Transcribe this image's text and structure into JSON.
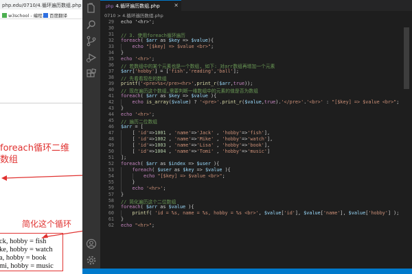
{
  "browser": {
    "tab_title": "php.edu/0710/4.循环遍历数组.php",
    "bookmarks": [
      {
        "label": "w3school - 编程...",
        "color": "#4caf50"
      },
      {
        "label": "百度翻译",
        "color": "#2f6fe0"
      }
    ],
    "note_foreach": "foreach循环二维\n数组",
    "note_simplify": "简化这个循环",
    "output_lines": [
      "ck, hobby = fish",
      "ke, hobby = watch",
      "a, hobby = book",
      "mi, hobby = music"
    ]
  },
  "editor": {
    "tab_label": "4.循环遍历数组.php",
    "tab_badge": "php",
    "breadcrumb": "0710 > 4.循环遍历数组.php",
    "accent_color": "#007acc"
  },
  "code": [
    {
      "n": "29",
      "ind": 0,
      "t": [
        [
          "pn",
          "echo '<hr>';"
        ]
      ]
    },
    {
      "n": "30",
      "ind": 0,
      "t": []
    },
    {
      "n": "31",
      "ind": 0,
      "t": [
        [
          "cm",
          "// 3. 使用foreach循环遍历"
        ]
      ]
    },
    {
      "n": "32",
      "ind": 0,
      "t": [
        [
          "kw",
          "foreach"
        ],
        [
          "pn",
          "( "
        ],
        [
          "var",
          "$arr"
        ],
        [
          "pn",
          " as "
        ],
        [
          "var",
          "$key"
        ],
        [
          "pn",
          " => "
        ],
        [
          "var",
          "$value"
        ],
        [
          "pn",
          "){"
        ]
      ]
    },
    {
      "n": "33",
      "ind": 1,
      "t": [
        [
          "kw",
          "echo"
        ],
        [
          "pn",
          " "
        ],
        [
          "str",
          "\"[$key] => $value <br>\""
        ],
        [
          "pn",
          ";"
        ]
      ]
    },
    {
      "n": "34",
      "ind": 0,
      "t": [
        [
          "pn",
          "}"
        ]
      ]
    },
    {
      "n": "35",
      "ind": 0,
      "t": [
        [
          "kw",
          "echo"
        ],
        [
          "pn",
          " "
        ],
        [
          "str",
          "'<hr>'"
        ],
        [
          "pn",
          ";"
        ]
      ]
    },
    {
      "n": "36",
      "ind": 0,
      "t": [
        [
          "cm",
          "// 若数组中的某个元素也是一个数组, 如下: 对arr数组再增加一个元素"
        ]
      ]
    },
    {
      "n": "37",
      "ind": 0,
      "t": [
        [
          "var",
          "$arr"
        ],
        [
          "pn",
          "["
        ],
        [
          "str",
          "'hobby'"
        ],
        [
          "pn",
          "] = ["
        ],
        [
          "str",
          "'fish'"
        ],
        [
          "pn",
          ","
        ],
        [
          "str",
          "'reading'"
        ],
        [
          "pn",
          ","
        ],
        [
          "str",
          "'ball'"
        ],
        [
          "pn",
          "];"
        ]
      ]
    },
    {
      "n": "38",
      "ind": 0,
      "t": [
        [
          "cm",
          "// 先看看现在的数组"
        ]
      ]
    },
    {
      "n": "39",
      "ind": 0,
      "t": [
        [
          "fn",
          "printf"
        ],
        [
          "pn",
          "("
        ],
        [
          "str",
          "'<pre>%s</pre><hr>'"
        ],
        [
          "pn",
          ","
        ],
        [
          "fn",
          "print_r"
        ],
        [
          "pn",
          "("
        ],
        [
          "var",
          "$arr"
        ],
        [
          "pn",
          ","
        ],
        [
          "kw",
          "true"
        ],
        [
          "pn",
          "));"
        ]
      ]
    },
    {
      "n": "40",
      "ind": 0,
      "t": [
        [
          "cm",
          "// 现在遍历这个数组,需要判断一维数组中的元素的值是否为数组"
        ]
      ]
    },
    {
      "n": "41",
      "ind": 0,
      "t": [
        [
          "kw",
          "foreach"
        ],
        [
          "pn",
          "( "
        ],
        [
          "var",
          "$arr"
        ],
        [
          "pn",
          " as "
        ],
        [
          "var",
          "$key"
        ],
        [
          "pn",
          " => "
        ],
        [
          "var",
          "$value"
        ],
        [
          "pn",
          " ){"
        ]
      ]
    },
    {
      "n": "42",
      "ind": 1,
      "t": [
        [
          "kw",
          "echo"
        ],
        [
          "pn",
          " "
        ],
        [
          "fn",
          "is_array"
        ],
        [
          "pn",
          "("
        ],
        [
          "var",
          "$value"
        ],
        [
          "pn",
          ") ? "
        ],
        [
          "str",
          "'<pre>'"
        ],
        [
          "pn",
          "."
        ],
        [
          "fn",
          "print_r"
        ],
        [
          "pn",
          "("
        ],
        [
          "var",
          "$value"
        ],
        [
          "pn",
          ","
        ],
        [
          "kw",
          "true"
        ],
        [
          "pn",
          ")."
        ],
        [
          "str",
          "'</pre>'"
        ],
        [
          "pn",
          "."
        ],
        [
          "str",
          "'<br>'"
        ],
        [
          "pn",
          " : "
        ],
        [
          "str",
          "\"[$key] => $value <br>\""
        ],
        [
          "pn",
          ";"
        ]
      ]
    },
    {
      "n": "43",
      "ind": 0,
      "t": [
        [
          "pn",
          "}"
        ]
      ]
    },
    {
      "n": "44",
      "ind": 0,
      "t": [
        [
          "kw",
          "echo"
        ],
        [
          "pn",
          " "
        ],
        [
          "str",
          "'<hr>'"
        ],
        [
          "pn",
          ";"
        ]
      ]
    },
    {
      "n": "45",
      "ind": 0,
      "t": [
        [
          "cm",
          "// 遍历二位数组"
        ]
      ]
    },
    {
      "n": "46",
      "ind": 0,
      "t": [
        [
          "var",
          "$arr"
        ],
        [
          "pn",
          " = ["
        ]
      ]
    },
    {
      "n": "47",
      "ind": 1,
      "t": [
        [
          "pn",
          "[ "
        ],
        [
          "str",
          "'id'"
        ],
        [
          "pn",
          "=>"
        ],
        [
          "num",
          "1001"
        ],
        [
          "pn",
          " , "
        ],
        [
          "str",
          "'name'"
        ],
        [
          "pn",
          "=>"
        ],
        [
          "str",
          "'Jack'"
        ],
        [
          "pn",
          " , "
        ],
        [
          "str",
          "'hobby'"
        ],
        [
          "pn",
          "=>"
        ],
        [
          "str",
          "'fish'"
        ],
        [
          "pn",
          "],"
        ]
      ]
    },
    {
      "n": "48",
      "ind": 1,
      "t": [
        [
          "pn",
          "[ "
        ],
        [
          "str",
          "'id'"
        ],
        [
          "pn",
          "=>"
        ],
        [
          "num",
          "1002"
        ],
        [
          "pn",
          " , "
        ],
        [
          "str",
          "'name'"
        ],
        [
          "pn",
          "=>"
        ],
        [
          "str",
          "'Mike'"
        ],
        [
          "pn",
          " , "
        ],
        [
          "str",
          "'hobby'"
        ],
        [
          "pn",
          "=>"
        ],
        [
          "str",
          "'watch'"
        ],
        [
          "pn",
          "],"
        ]
      ]
    },
    {
      "n": "49",
      "ind": 1,
      "t": [
        [
          "pn",
          "[ "
        ],
        [
          "str",
          "'id'"
        ],
        [
          "pn",
          "=>"
        ],
        [
          "num",
          "1003"
        ],
        [
          "pn",
          " , "
        ],
        [
          "str",
          "'name'"
        ],
        [
          "pn",
          "=>"
        ],
        [
          "str",
          "'Lisa'"
        ],
        [
          "pn",
          " , "
        ],
        [
          "str",
          "'hobby'"
        ],
        [
          "pn",
          "=>"
        ],
        [
          "str",
          "'book'"
        ],
        [
          "pn",
          "],"
        ]
      ]
    },
    {
      "n": "50",
      "ind": 1,
      "t": [
        [
          "pn",
          "[ "
        ],
        [
          "str",
          "'id'"
        ],
        [
          "pn",
          "=>"
        ],
        [
          "num",
          "1004"
        ],
        [
          "pn",
          " , "
        ],
        [
          "str",
          "'name'"
        ],
        [
          "pn",
          "=>"
        ],
        [
          "str",
          "'Tomi'"
        ],
        [
          "pn",
          " , "
        ],
        [
          "str",
          "'hobby'"
        ],
        [
          "pn",
          "=>"
        ],
        [
          "str",
          "'music'"
        ],
        [
          "pn",
          "]"
        ]
      ]
    },
    {
      "n": "51",
      "ind": 0,
      "t": [
        [
          "pn",
          "];"
        ]
      ]
    },
    {
      "n": "52",
      "ind": 0,
      "t": [
        [
          "kw",
          "foreach"
        ],
        [
          "pn",
          "( "
        ],
        [
          "var",
          "$arr"
        ],
        [
          "pn",
          " as "
        ],
        [
          "var",
          "$index"
        ],
        [
          "pn",
          " => "
        ],
        [
          "var",
          "$user"
        ],
        [
          "pn",
          " ){"
        ]
      ]
    },
    {
      "n": "53",
      "ind": 1,
      "t": [
        [
          "kw",
          "foreach"
        ],
        [
          "pn",
          "( "
        ],
        [
          "var",
          "$user"
        ],
        [
          "pn",
          " as "
        ],
        [
          "var",
          "$key"
        ],
        [
          "pn",
          " => "
        ],
        [
          "var",
          "$value"
        ],
        [
          "pn",
          " ){"
        ]
      ]
    },
    {
      "n": "54",
      "ind": 2,
      "t": [
        [
          "kw",
          "echo"
        ],
        [
          "pn",
          " "
        ],
        [
          "str",
          "\"[$key] => $value <br>\""
        ],
        [
          "pn",
          ";"
        ]
      ]
    },
    {
      "n": "55",
      "ind": 1,
      "t": [
        [
          "pn",
          "}"
        ]
      ]
    },
    {
      "n": "56",
      "ind": 1,
      "t": [
        [
          "kw",
          "echo"
        ],
        [
          "pn",
          " "
        ],
        [
          "str",
          "'<hr>'"
        ],
        [
          "pn",
          ";"
        ]
      ]
    },
    {
      "n": "57",
      "ind": 0,
      "t": [
        [
          "pn",
          "}"
        ]
      ]
    },
    {
      "n": "58",
      "ind": 0,
      "t": [
        [
          "cm",
          "// 简化遍历这个二位数组"
        ]
      ]
    },
    {
      "n": "59",
      "ind": 0,
      "t": [
        [
          "kw",
          "foreach"
        ],
        [
          "pn",
          "( "
        ],
        [
          "var",
          "$arr"
        ],
        [
          "pn",
          " as "
        ],
        [
          "var",
          "$value"
        ],
        [
          "pn",
          " ){"
        ]
      ]
    },
    {
      "n": "60",
      "ind": 1,
      "t": [
        [
          "fn",
          "printf"
        ],
        [
          "pn",
          "( "
        ],
        [
          "str",
          "'id = %s, name = %s, hobby = %s <br>'"
        ],
        [
          "pn",
          ", "
        ],
        [
          "var",
          "$value"
        ],
        [
          "pn",
          "["
        ],
        [
          "str",
          "'id'"
        ],
        [
          "pn",
          "], "
        ],
        [
          "var",
          "$value"
        ],
        [
          "pn",
          "["
        ],
        [
          "str",
          "'name'"
        ],
        [
          "pn",
          "], "
        ],
        [
          "var",
          "$value"
        ],
        [
          "pn",
          "["
        ],
        [
          "str",
          "'hobby'"
        ],
        [
          "pn",
          "] );"
        ]
      ]
    },
    {
      "n": "61",
      "ind": 0,
      "t": [
        [
          "pn",
          "}"
        ]
      ]
    },
    {
      "n": "62",
      "ind": 0,
      "t": [
        [
          "kw",
          "echo"
        ],
        [
          "pn",
          " "
        ],
        [
          "str",
          "\"<hr>\""
        ],
        [
          "pn",
          ";"
        ]
      ]
    }
  ]
}
